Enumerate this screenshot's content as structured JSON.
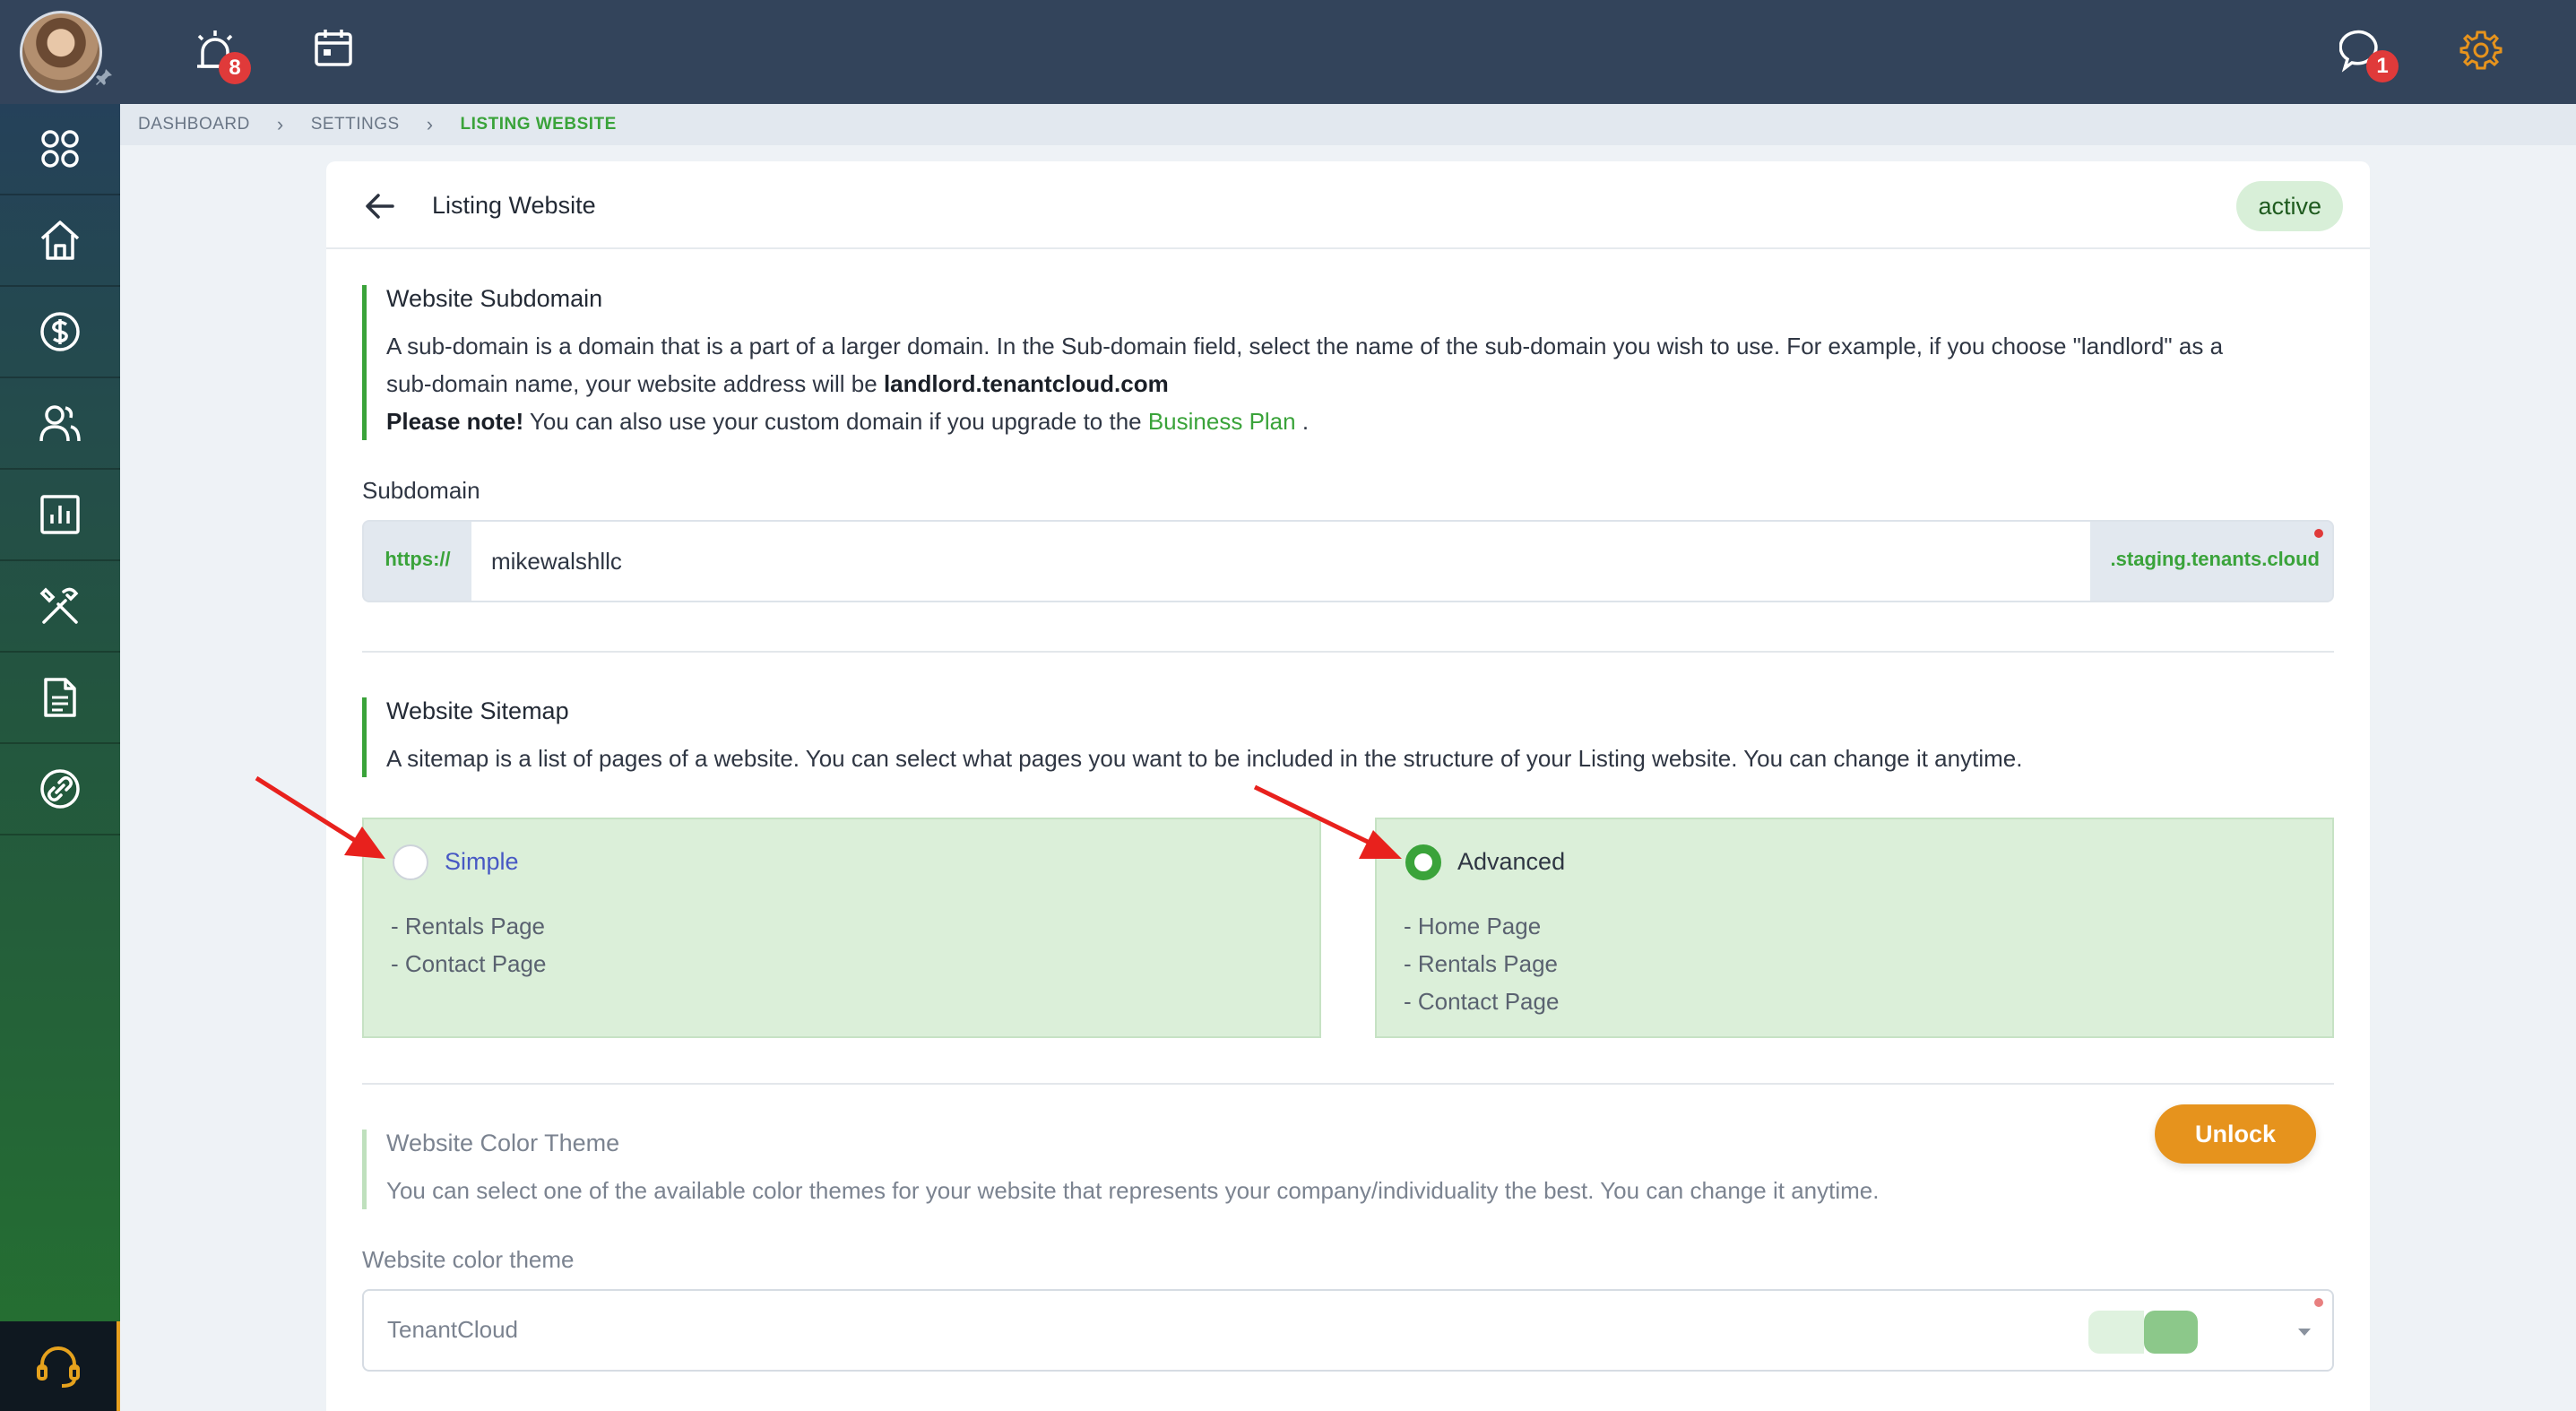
{
  "topbar": {
    "notification_count": "8",
    "chat_count": "1"
  },
  "breadcrumb": [
    "DASHBOARD",
    "SETTINGS",
    "LISTING WEBSITE"
  ],
  "page": {
    "title": "Listing Website",
    "status": "active"
  },
  "subdomain_section": {
    "title": "Website Subdomain",
    "desc_line1": "A sub-domain is a domain that is a part of a larger domain. In the Sub-domain field, select the name of the sub-domain you wish to use. For example, if you choose \"landlord\" as a",
    "desc_line2_prefix": "sub-domain name, your website address will be ",
    "desc_line2_bold": "landlord.tenantcloud.com",
    "note_bold": "Please note!",
    "note_text": " You can also use your custom domain if you upgrade to the ",
    "note_link": "Business Plan",
    "note_end": " .",
    "field_label": "Subdomain",
    "prefix": "https://",
    "value": "mikewalshllc",
    "suffix": ".staging.tenants.cloud"
  },
  "sitemap_section": {
    "title": "Website Sitemap",
    "desc": "A sitemap is a list of pages of a website. You can select what pages you want to be included in the structure of your Listing website. You can change it anytime.",
    "options": [
      {
        "label": "Simple",
        "selected": false,
        "pages": [
          "- Rentals Page",
          "- Contact Page"
        ]
      },
      {
        "label": "Advanced",
        "selected": true,
        "pages": [
          "- Home Page",
          "- Rentals Page",
          "- Contact Page"
        ]
      }
    ]
  },
  "theme_section": {
    "title": "Website Color Theme",
    "desc": "You can select one of the available color themes for your website that represents your company/individuality the best. You can change it anytime.",
    "unlock_label": "Unlock",
    "field_label": "Website color theme",
    "value": "TenantCloud"
  },
  "colors": {
    "accent_green": "#3aa33a",
    "topbar": "#33445b",
    "unlock_orange": "#e6931d",
    "badge_red": "#e03a3a"
  }
}
